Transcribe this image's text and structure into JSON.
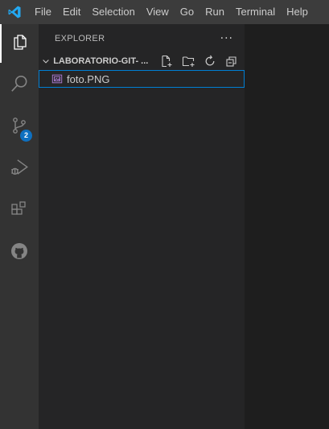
{
  "menubar": {
    "logo_icon": "vscode-logo-icon",
    "items": [
      "File",
      "Edit",
      "Selection",
      "View",
      "Go",
      "Run",
      "Terminal",
      "Help"
    ]
  },
  "activity_bar": {
    "items": [
      {
        "icon": "files-icon",
        "active": true
      },
      {
        "icon": "search-icon",
        "active": false
      },
      {
        "icon": "source-control-icon",
        "active": false,
        "badge": "2"
      },
      {
        "icon": "run-debug-icon",
        "active": false
      },
      {
        "icon": "extensions-icon",
        "active": false
      },
      {
        "icon": "github-icon",
        "active": false
      }
    ]
  },
  "sidebar": {
    "title": "EXPLORER",
    "more_icon": "ellipsis-icon",
    "folder": {
      "name": "LABORATORIO-GIT- ...",
      "actions": [
        "new-file-icon",
        "new-folder-icon",
        "refresh-icon",
        "collapse-all-icon"
      ]
    },
    "files": [
      {
        "name": "foto.PNG",
        "icon": "image-file-icon",
        "selected": true
      }
    ]
  },
  "colors": {
    "accent": "#007fd4",
    "badge": "#0e70c0",
    "image_icon": "#a074c4"
  }
}
